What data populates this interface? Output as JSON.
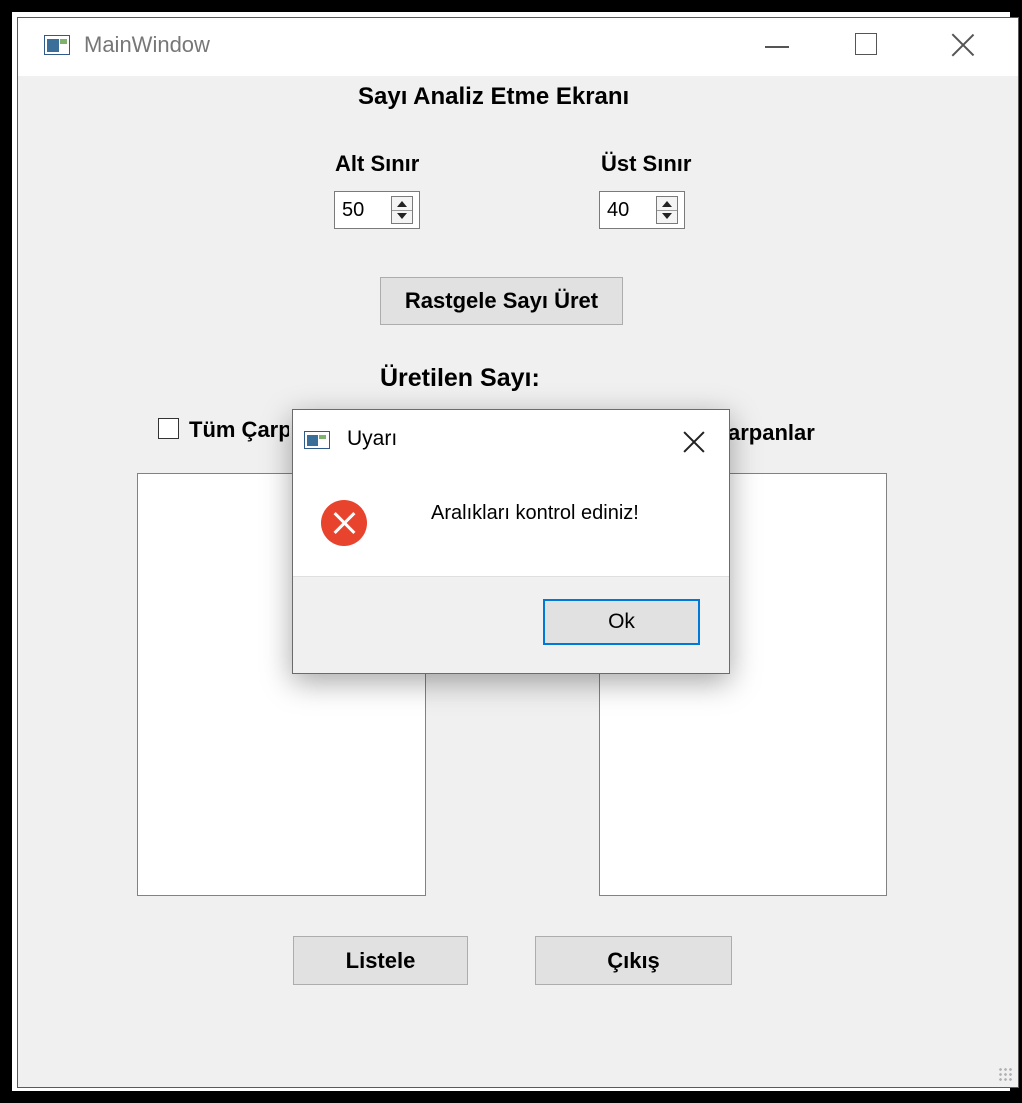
{
  "window": {
    "title": "MainWindow"
  },
  "main": {
    "heading": "Sayı Analiz Etme Ekranı",
    "lower_bound": {
      "label": "Alt Sınır",
      "value": "50"
    },
    "upper_bound": {
      "label": "Üst Sınır",
      "value": "40"
    },
    "random_button": "Rastgele Sayı Üret",
    "produced_label": "Üretilen Sayı:",
    "checkbox_left_label": "Tüm Çarpanlar",
    "checkbox_left_checked": false,
    "checkbox_right_label": "arpanlar",
    "list_button": "Listele",
    "exit_button": "Çıkış"
  },
  "dialog": {
    "title": "Uyarı",
    "message": "Aralıkları kontrol ediniz!",
    "ok_button": "Ok",
    "icon": "error-icon",
    "accent_color": "#0078d7",
    "error_color": "#e8432d"
  }
}
